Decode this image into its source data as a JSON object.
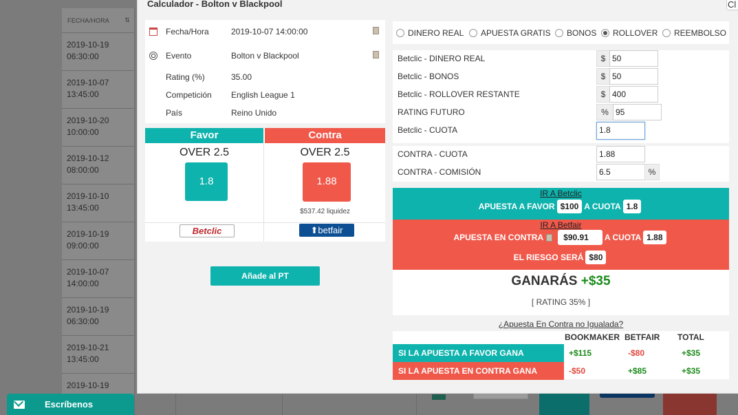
{
  "background": {
    "column_header": "FECHA/HORA",
    "sort_glyph": "⇅",
    "rows": [
      {
        "date": "2019-10-19",
        "time": "06:30:00"
      },
      {
        "date": "2019-10-07",
        "time": "13:45:00"
      },
      {
        "date": "2019-10-20",
        "time": "10:00:00"
      },
      {
        "date": "2019-10-12",
        "time": "08:00:00"
      },
      {
        "date": "2019-10-10",
        "time": "13:45:00"
      },
      {
        "date": "2019-10-19",
        "time": "09:00:00"
      },
      {
        "date": "2019-10-07",
        "time": "14:00:00"
      },
      {
        "date": "2019-10-19",
        "time": "06:30:00"
      },
      {
        "date": "2019-10-21",
        "time": "13:45:00"
      },
      {
        "date": "2019-10-19",
        "time": ""
      }
    ]
  },
  "chat": {
    "label": "Escríbenos"
  },
  "modal": {
    "title": "Calculador - Bolton v Blackpool",
    "close_label": "Cl",
    "info": {
      "datetime_label": "Fecha/Hora",
      "datetime_value": "2019-10-07 14:00:00",
      "event_label": "Evento",
      "event_value": "Bolton v Blackpool",
      "rating_label": "Rating (%)",
      "rating_value": "35.00",
      "competition_label": "Competición",
      "competition_value": "English League 1",
      "country_label": "País",
      "country_value": "Reino Unido"
    },
    "favor": {
      "header": "Favor",
      "market": "OVER 2.5",
      "odds": "1.8",
      "bookmaker": "Betclic"
    },
    "contra": {
      "header": "Contra",
      "market": "OVER 2.5",
      "odds": "1.88",
      "liquidity": "$537.42 liquidez",
      "exchange": "betfair"
    },
    "add_button": "Añade al PT",
    "modes": [
      {
        "label": "DINERO REAL",
        "selected": false
      },
      {
        "label": "APUESTA GRATIS",
        "selected": false
      },
      {
        "label": "BONOS",
        "selected": false
      },
      {
        "label": "ROLLOVER",
        "selected": true
      },
      {
        "label": "REEMBOLSO",
        "selected": false
      }
    ],
    "fields": {
      "real_money": {
        "label": "Betclic - DINERO REAL",
        "addon": "$",
        "value": "50"
      },
      "bonus": {
        "label": "Betclic - BONOS",
        "addon": "$",
        "value": "50"
      },
      "rollover": {
        "label": "Betclic - ROLLOVER RESTANTE",
        "addon": "$",
        "value": "400"
      },
      "future_rating": {
        "label": "RATING FUTURO",
        "addon": "%",
        "value": "95"
      },
      "bookie_odds": {
        "label": "Betclic - CUOTA",
        "value": "1.8"
      },
      "lay_odds": {
        "label": "CONTRA - CUOTA",
        "value": "1.88"
      },
      "commission": {
        "label": "CONTRA - COMISIÓN",
        "value": "6.5",
        "addon": "%"
      }
    },
    "back_bet": {
      "link": "IR A Betclic",
      "text": "APUESTA A FAVOR",
      "stake": "$100",
      "odds_text": "A CUOTA",
      "odds": "1.8"
    },
    "lay_bet": {
      "link": "IR A Betfair",
      "text": "APUESTA EN CONTRA",
      "stake": "$90.91",
      "odds_text": "A CUOTA",
      "odds": "1.88",
      "risk_text": "EL RIESGO SERÁ",
      "risk": "$80"
    },
    "result": {
      "label": "GANARÁS",
      "amount": "+$35",
      "rating": "[ RATING 35% ]"
    },
    "unmatched_link": "¿Apuesta En Contra no Igualada?",
    "summary": {
      "headers": [
        "BOOKMAKER",
        "BETFAIR",
        "TOTAL"
      ],
      "rows": [
        {
          "label": "SI LA APUESTA A FAVOR GANA",
          "bookmaker": "+$115",
          "betfair": "-$80",
          "total": "+$35"
        },
        {
          "label": "SI LA APUESTA EN CONTRA GANA",
          "bookmaker": "-$50",
          "betfair": "+$85",
          "total": "+$35"
        }
      ]
    }
  }
}
